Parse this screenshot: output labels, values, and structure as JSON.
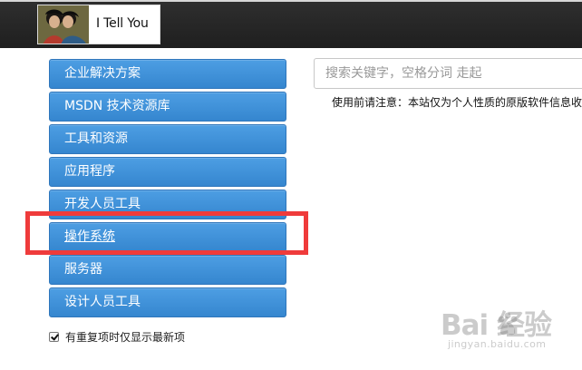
{
  "header": {
    "logo_text": "I Tell You"
  },
  "sidebar": {
    "items": [
      {
        "label": "企业解决方案"
      },
      {
        "label": "MSDN 技术资源库"
      },
      {
        "label": "工具和资源"
      },
      {
        "label": "应用程序"
      },
      {
        "label": "开发人员工具"
      },
      {
        "label": "操作系统"
      },
      {
        "label": "服务器"
      },
      {
        "label": "设计人员工具"
      }
    ],
    "checkbox_label": "有重复项时仅显示最新项"
  },
  "search": {
    "placeholder": "搜索关键字，空格分词 走起"
  },
  "notice": {
    "text": "使用前请注意：本站仅为个人性质的原版软件信息收"
  },
  "watermark": {
    "main": "Bai 经验",
    "sub": "jingyan.baidu.com"
  },
  "colors": {
    "menu_blue": "#3f93dc",
    "highlight_red": "#ef3b3b",
    "topbar_dark": "#262626"
  },
  "icons": {
    "checkbox": "check-icon",
    "watermark_logo": "baidu-paw-icon"
  }
}
